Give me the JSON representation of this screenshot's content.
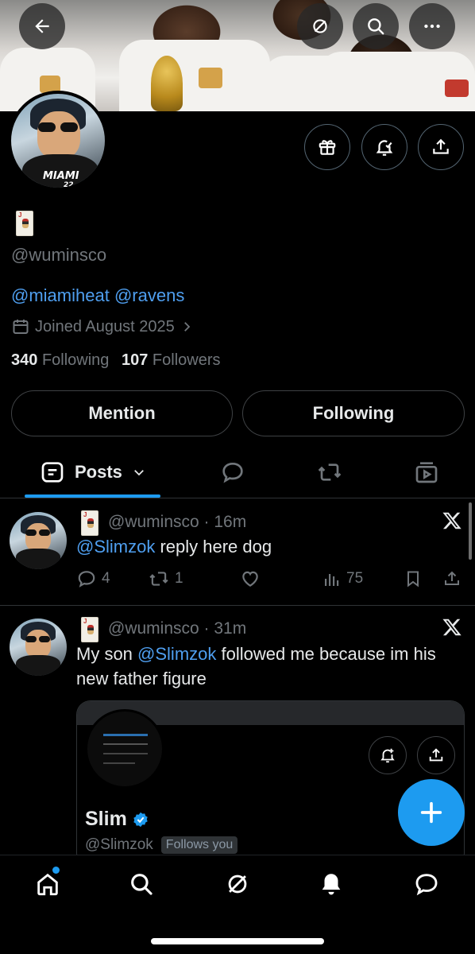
{
  "profile": {
    "handle": "@wuminsco",
    "bio_mentions": [
      "@miamiheat",
      "@ravens"
    ],
    "joined": "Joined August 2025",
    "following_count": "340",
    "following_label": "Following",
    "followers_count": "107",
    "followers_label": "Followers",
    "avatar_jersey_text": "MIAMI",
    "avatar_jersey_number": "22"
  },
  "buttons": {
    "mention": "Mention",
    "following": "Following"
  },
  "tabs": {
    "posts_label": "Posts"
  },
  "tweets": [
    {
      "handle": "@wuminsco",
      "time": "16m",
      "mention": "@Slimzok",
      "text_after": " reply here dog",
      "replies": "4",
      "reposts": "1",
      "views": "75"
    },
    {
      "handle": "@wuminsco",
      "time": "31m",
      "text_before": "My son ",
      "mention": "@Slimzok",
      "text_after": " followed me because im his new father figure"
    }
  ],
  "quoted": {
    "name": "Slim",
    "handle": "@Slimzok",
    "badge": "Follows you"
  },
  "colors": {
    "accent": "#1d9bf0",
    "link": "#4f9ff0",
    "muted": "#71767b",
    "background": "#000000"
  },
  "icons": [
    "back-arrow-icon",
    "grok-icon",
    "search-icon",
    "more-icon",
    "gift-icon",
    "notification-bell-icon",
    "share-icon",
    "calendar-icon",
    "chevron-right-icon",
    "posts-icon",
    "chevron-down-icon",
    "replies-icon",
    "reposts-icon",
    "media-icon",
    "x-logo-icon",
    "reply-icon",
    "repost-icon",
    "like-icon",
    "views-icon",
    "bookmark-icon",
    "plus-icon",
    "home-icon",
    "bell-icon",
    "messages-icon",
    "verified-icon"
  ]
}
